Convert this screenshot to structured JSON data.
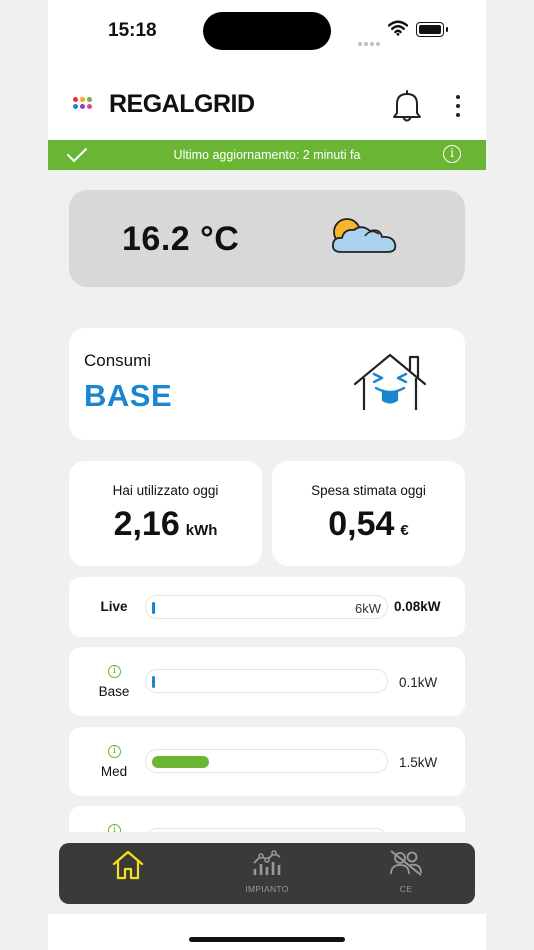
{
  "status_bar": {
    "time": "15:18"
  },
  "header": {
    "logo_text": "REGALGRID",
    "logo_dot_colors": [
      "#e4312b",
      "#f5a623",
      "#6ab534",
      "#1a86d0",
      "#8e44ad",
      "#e84393"
    ]
  },
  "update_bar": {
    "text": "Ultimo aggiornamento: 2 minuti fa",
    "color": "#6ab534"
  },
  "weather": {
    "temperature": "16.2 °C",
    "icon": "partly-cloudy-icon"
  },
  "consumi": {
    "title": "Consumi",
    "level": "BASE",
    "level_color": "#1a86d0"
  },
  "stats": {
    "used": {
      "label": "Hai utilizzato oggi",
      "value": "2,16",
      "unit": "kWh"
    },
    "cost": {
      "label": "Spesa stimata oggi",
      "value": "0,54",
      "unit": "€"
    }
  },
  "levels": {
    "live": {
      "label": "Live",
      "scale": "6kW",
      "value": "0.08kW",
      "fill_fraction": 0.013,
      "color": "#1a86d0"
    },
    "base": {
      "label": "Base",
      "value": "0.1kW",
      "fill_fraction": 0.013,
      "color": "#1a86d0"
    },
    "med": {
      "label": "Med",
      "value": "1.5kW",
      "fill_fraction": 0.25,
      "color": "#6ab534"
    }
  },
  "tabbar": {
    "home": {
      "label": "",
      "icon": "home-icon",
      "active_color": "#f5e21c"
    },
    "impianto": {
      "label": "IMPIANTO",
      "icon": "chart-icon"
    },
    "ce": {
      "label": "CE",
      "icon": "users-off-icon"
    }
  }
}
